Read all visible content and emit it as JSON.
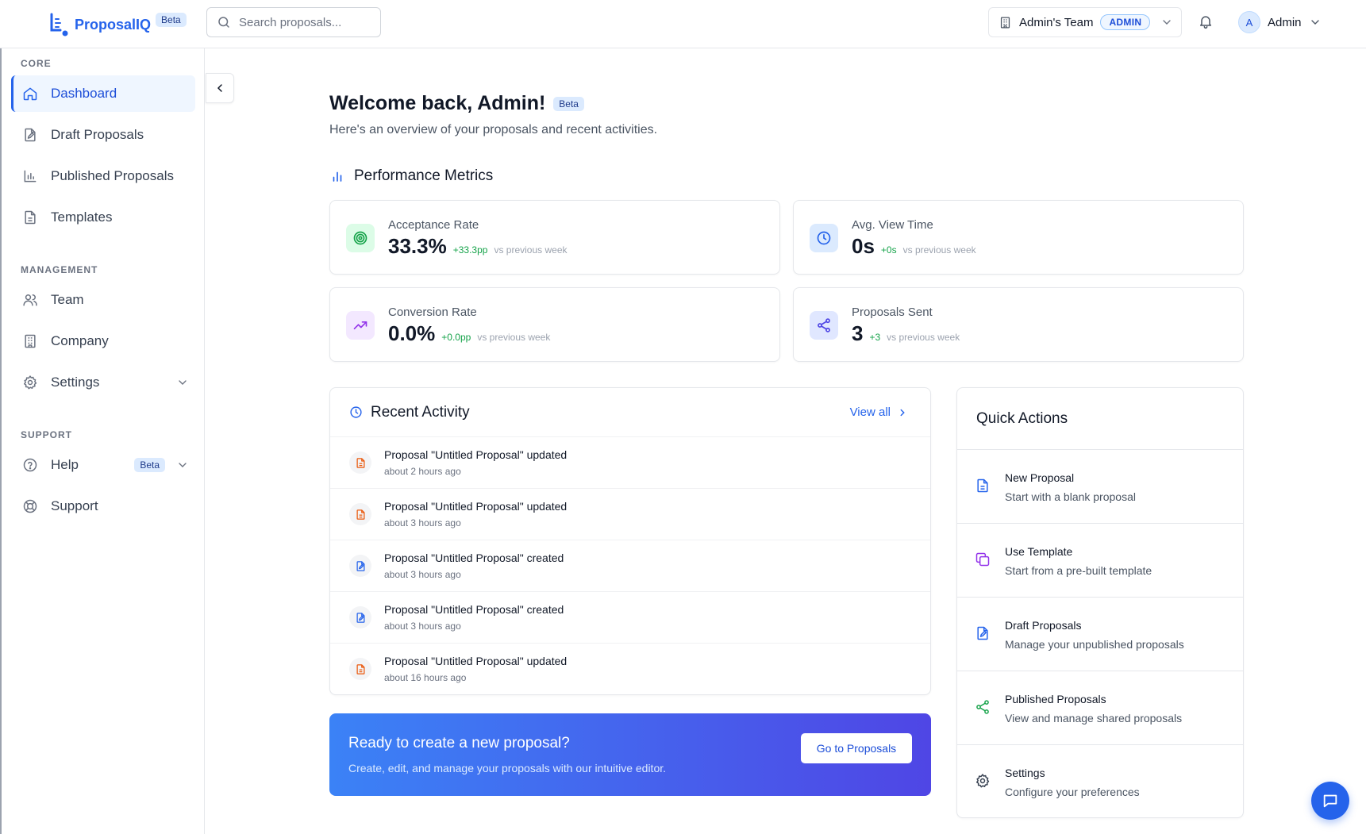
{
  "app": {
    "name": "ProposalIQ",
    "badge": "Beta"
  },
  "search": {
    "placeholder": "Search proposals..."
  },
  "team": {
    "name": "Admin's Team",
    "role": "ADMIN"
  },
  "user": {
    "initial": "A",
    "name": "Admin"
  },
  "sidebar": {
    "core_title": "CORE",
    "core": [
      {
        "label": "Dashboard",
        "icon": "home-icon",
        "active": true
      },
      {
        "label": "Draft Proposals",
        "icon": "file-edit-icon"
      },
      {
        "label": "Published Proposals",
        "icon": "bar-chart-icon"
      },
      {
        "label": "Templates",
        "icon": "file-text-icon"
      }
    ],
    "management_title": "MANAGEMENT",
    "management": [
      {
        "label": "Team",
        "icon": "users-icon"
      },
      {
        "label": "Company",
        "icon": "building-icon"
      },
      {
        "label": "Settings",
        "icon": "gear-icon"
      }
    ],
    "support_title": "SUPPORT",
    "support": [
      {
        "label": "Help",
        "icon": "help-circle-icon",
        "badge": "Beta"
      },
      {
        "label": "Support",
        "icon": "life-buoy-icon"
      }
    ]
  },
  "welcome": {
    "title": "Welcome back, Admin!",
    "badge": "Beta",
    "subtitle": "Here's an overview of your proposals and recent activities."
  },
  "metrics": {
    "title": "Performance Metrics",
    "items": [
      {
        "label": "Acceptance Rate",
        "value": "33.3%",
        "delta": "+33.3pp",
        "vs": "vs previous week",
        "icon": "target-icon",
        "color": "#16a34a"
      },
      {
        "label": "Avg. View Time",
        "value": "0s",
        "delta": "+0s",
        "vs": "vs previous week",
        "icon": "clock-icon",
        "color": "#2563eb"
      },
      {
        "label": "Conversion Rate",
        "value": "0.0%",
        "delta": "+0.0pp",
        "vs": "vs previous week",
        "icon": "trending-up-icon",
        "color": "#9333ea"
      },
      {
        "label": "Proposals Sent",
        "value": "3",
        "delta": "+3",
        "vs": "vs previous week",
        "icon": "share-icon",
        "color": "#4f46e5"
      }
    ]
  },
  "activity": {
    "title": "Recent Activity",
    "view_all": "View all",
    "items": [
      {
        "title": "Proposal \"Untitled Proposal\" updated",
        "time": "about 2 hours ago",
        "icon": "file-icon"
      },
      {
        "title": "Proposal \"Untitled Proposal\" updated",
        "time": "about 3 hours ago",
        "icon": "file-icon"
      },
      {
        "title": "Proposal \"Untitled Proposal\" created",
        "time": "about 3 hours ago",
        "icon": "file-edit-icon"
      },
      {
        "title": "Proposal \"Untitled Proposal\" created",
        "time": "about 3 hours ago",
        "icon": "file-edit-icon"
      },
      {
        "title": "Proposal \"Untitled Proposal\" updated",
        "time": "about 16 hours ago",
        "icon": "file-icon"
      }
    ]
  },
  "cta": {
    "title": "Ready to create a new proposal?",
    "text": "Create, edit, and manage your proposals with our intuitive editor.",
    "button": "Go to Proposals"
  },
  "quick_actions": {
    "title": "Quick Actions",
    "items": [
      {
        "title": "New Proposal",
        "subtitle": "Start with a blank proposal",
        "icon": "file-text-icon"
      },
      {
        "title": "Use Template",
        "subtitle": "Start from a pre-built template",
        "icon": "copy-icon"
      },
      {
        "title": "Draft Proposals",
        "subtitle": "Manage your unpublished proposals",
        "icon": "file-edit-icon"
      },
      {
        "title": "Published Proposals",
        "subtitle": "View and manage shared proposals",
        "icon": "share-icon"
      },
      {
        "title": "Settings",
        "subtitle": "Configure your preferences",
        "icon": "gear-icon"
      }
    ]
  },
  "colors": {
    "accent": "#2563eb",
    "success": "#16a34a",
    "orange": "#ea580c",
    "purple": "#9333ea"
  }
}
